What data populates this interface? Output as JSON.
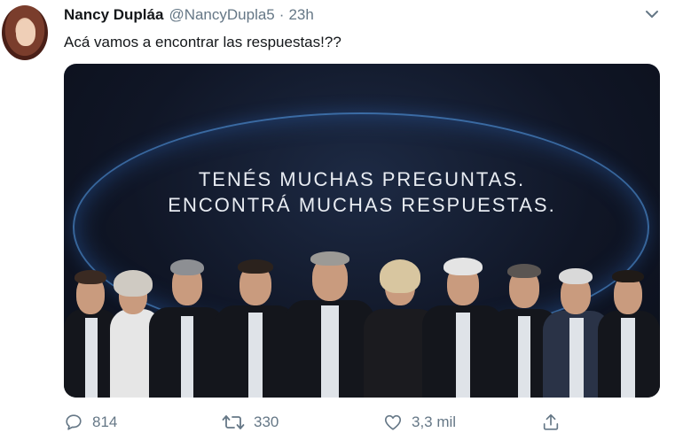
{
  "author": {
    "name": "Nancy Dupláa",
    "handle": "@NancyDupla5",
    "separator": "·",
    "time": "23h"
  },
  "tweet": {
    "text": "Acá vamos a encontrar las respuestas!??"
  },
  "media": {
    "line1": "TENÉS MUCHAS PREGUNTAS.",
    "line2": "ENCONTRÁ MUCHAS RESPUESTAS."
  },
  "actions": {
    "reply_count": "814",
    "retweet_count": "330",
    "like_count": "3,3 mil"
  },
  "icons": {
    "menu": "chevron-down-icon",
    "reply": "reply-icon",
    "retweet": "retweet-icon",
    "like": "heart-icon",
    "share": "share-icon"
  },
  "colors": {
    "text": "#14171a",
    "secondary": "#657786",
    "image_bg": "#101626",
    "glow": "#5aaaff"
  }
}
